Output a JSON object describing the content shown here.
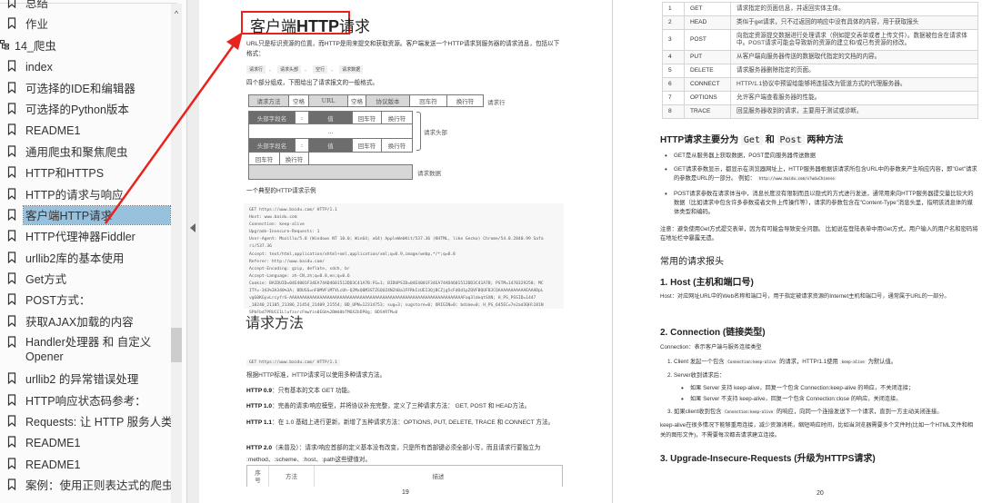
{
  "sidebar": {
    "items": [
      {
        "label": "总结",
        "type": "bookmark"
      },
      {
        "label": "作业",
        "type": "bookmark"
      },
      {
        "label": "14_爬虫",
        "type": "group"
      },
      {
        "label": "index",
        "type": "bookmark"
      },
      {
        "label": "可选择的IDE和编辑器",
        "type": "bookmark"
      },
      {
        "label": "可选择的Python版本",
        "type": "bookmark"
      },
      {
        "label": "README1",
        "type": "bookmark"
      },
      {
        "label": "通用爬虫和聚焦爬虫",
        "type": "bookmark"
      },
      {
        "label": "HTTP和HTTPS",
        "type": "bookmark"
      },
      {
        "label": "HTTP的请求与响应",
        "type": "bookmark"
      },
      {
        "label": "客户端HTTP请求",
        "type": "bookmark",
        "selected": true
      },
      {
        "label": "HTTP代理神器Fiddler",
        "type": "bookmark"
      },
      {
        "label": "urllib2库的基本使用",
        "type": "bookmark"
      },
      {
        "label": "Get方式",
        "type": "bookmark"
      },
      {
        "label": "POST方式：",
        "type": "bookmark"
      },
      {
        "label": "获取AJAX加载的内容",
        "type": "bookmark"
      },
      {
        "label": "Handler处理器 和 自定义Opener",
        "type": "bookmark",
        "tall": true
      },
      {
        "label": "urllib2 的异常错误处理",
        "type": "bookmark"
      },
      {
        "label": "HTTP响应状态码参考：",
        "type": "bookmark"
      },
      {
        "label": "Requests: 让 HTTP 服务人类",
        "type": "bookmark"
      },
      {
        "label": "README1",
        "type": "bookmark"
      },
      {
        "label": "README1",
        "type": "bookmark"
      },
      {
        "label": "案例：使用正则表达式的爬虫",
        "type": "bookmark"
      }
    ],
    "scroll_up_glyph": "^",
    "scroll_position": 0.78
  },
  "annotation": {
    "color": "#e8231e"
  },
  "page19": {
    "title_cn1": "客户端",
    "title_bold": "HTTP",
    "title_cn2": "请求",
    "intro": "URL只是标识资源的位置，而HTTP是用来提交和获取资源。客户端发送一个HTTP请求到服务器的请求消息，包括以下格式：",
    "tokens": [
      "请求行",
      "请求头部",
      "空行",
      "请求数据"
    ],
    "token_sep": "、",
    "four_parts": "四个部分组成，下图给出了请求报文的一般格式。",
    "diagram": {
      "row1": [
        "请求方法",
        "空格",
        "URL",
        "空格",
        "协议版本",
        "回车符",
        "换行符"
      ],
      "row1_label": "请求行",
      "header_name": "头部字段名",
      "colon": ":",
      "value": "值",
      "cr": "回车符",
      "lf": "换行符",
      "ellipsis": "…",
      "header_label": "请求头部",
      "data_label": "请求数据"
    },
    "example_caption": "一个典型的HTTP请求示例",
    "code_lines": [
      "GET https://www.baidu.com/ HTTP/1.1",
      "Host: www.baidu.com",
      "Connection: keep-alive",
      "Upgrade-Insecure-Requests: 1",
      "User-Agent: Mozilla/5.0 (Windows NT 10.0; Win64; x64) AppleWebKit/537.36 (KHTML, like Gecko) Chrome/54.0.2840.99 Safa",
      "ri/537.36",
      "Accept: text/html,application/xhtml+xml,application/xml;q=0.9,image/webp,*/*;q=0.8",
      "Referer: http://www.baidu.com/",
      "Accept-Encoding: gzip, deflate, sdch, br",
      "Accept-Language: zh-CN,zh;q=0.8,en;q=0.6",
      "Cookie: BAIDUID=04E4001F34EA74AD4601512DD3C41A7B:FG=1; BIDUPSID=04E4001F34EA74AD4601512DD3C41A7B; PSTM=1470329258; MC",
      "ITY=-343%3A340%3A; BDUSS=nF0MVFiMTVLcUh-Q2MxQ0M3STZGQUZ4N2hBa1FFRkIzUEI3QjBCZjg5cFdOd1pZQVFBQUFBJCQAAAAAAAAAAAEAAADpL",
      "vgG0KGyvLrcyfrG-AAAAAAAAAAAAAAAAAAAAAAAAAAAAAAAAAAAAAAAAAAAAAAAAAAAAAAAAAAAAAAAAAAAAAFaq3ldeqtSXN; H_PS_PSSID=1447",
      "_18240_21105_21386_21454_21409_21554; BD_UPN=12314753; sug=3; sugstore=0; ORIGIN=0; bdime=0; H_PS_645EC=7e2ad3QHl181N",
      "SPbFbd7PRUCE1LlufzxrcFmwYin0E6b%2BWd0bTMOXZbDP0g; BDSVRTM=0"
    ],
    "section_heading": "请求方法",
    "request_line_code": "GET https://www.baidu.com/ HTTP/1.1",
    "paragraphs": [
      {
        "bold": "",
        "text": "根据HTTP标准，HTTP请求可以使用多种请求方法。"
      },
      {
        "bold": "HTTP 0.9",
        "text": "：只有基本的文本 GET 功能。"
      },
      {
        "bold": "HTTP 1.0",
        "text": "：完善的请求/响应模型，并将协议补充完整，定义了三种请求方法： GET, POST 和 HEAD方法。"
      },
      {
        "bold": "HTTP 1.1",
        "text": "：在 1.0 基础上进行更新，新增了五种请求方法：OPTIONS, PUT, DELETE, TRACE 和 CONNECT 方法。"
      },
      {
        "bold": "HTTP 2.0",
        "text": "（未普及）：请求/响应首部的定义基本没有改变，只是所有首部键必须全部小写，而且请求行要独立为 :method、:scheme、:host、:path这些键值对。"
      }
    ],
    "table_headers": [
      "序号",
      "方法",
      "描述"
    ],
    "page_number": "19"
  },
  "page20": {
    "methods": [
      {
        "n": "1",
        "method": "GET",
        "desc": "请求指定的页面信息，并返回实体主体。"
      },
      {
        "n": "2",
        "method": "HEAD",
        "desc": "类似于get请求，只不过返回的响应中没有具体的内容，用于获取报头"
      },
      {
        "n": "3",
        "method": "POST",
        "desc": "向指定资源提交数据进行处理请求（例如提交表单或者上传文件）。数据被包含在请求体中。POST请求可能会导致新的资源的建立和/或已有资源的修改。"
      },
      {
        "n": "4",
        "method": "PUT",
        "desc": "从客户端向服务器传送的数据取代指定的文档的内容。"
      },
      {
        "n": "5",
        "method": "DELETE",
        "desc": "请求服务器删除指定的页面。"
      },
      {
        "n": "6",
        "method": "CONNECT",
        "desc": "HTTP/1.1协议中预留给能够将连接改为管道方式的代理服务器。"
      },
      {
        "n": "7",
        "method": "OPTIONS",
        "desc": "允许客户端查看服务器的性能。"
      },
      {
        "n": "8",
        "method": "TRACE",
        "desc": "回显服务器收到的请求，主要用于测试或诊断。"
      }
    ],
    "getpost_heading_pre": "HTTP请求主要分为",
    "getpost_get": "Get",
    "getpost_and": "和",
    "getpost_post": "Post",
    "getpost_heading_post": "两种方法",
    "bullets": [
      "GET是从服务器上获取数据，POST是向服务器传送数据",
      "GET请求参数显示，都显示在浏览器网址上，HTTP服务器根据该请求所包含URL中的参数来产生响应内容，即\"Get\"请求的参数是URL的一部分。 例如：",
      "POST请求参数在请求体当中，消息长度没有限制而且以隐式的方式进行发送，通常用来向HTTP服务器提交量比较大的数据（比如请求中包含许多参数或者文件上传操作等），请求的参数包含在\"Content-Type\"消息头里，指明该消息体的媒体类型和编码。"
    ],
    "bullet_example_code": "http://www.baidu.com/s?wd=Chinese",
    "note": "注意：避免使用Get方式提交表单，因为有可能会导致安全问题。 比如说在登陆表单中用Get方式，用户输入的用户名和密码将在地址栏中暴露无遗。",
    "common_headers": "常用的请求报头",
    "host_heading": "1. Host (主机和端口号)",
    "host_text": "Host：对应网址URL中的Web名称和端口号，用于指定被请求资源的Internet主机和端口号，通常属于URL的一部分。",
    "conn_heading": "2. Connection (链接类型)",
    "conn_text": "Connection：表示客户端与服务连接类型",
    "conn_items": [
      {
        "num": "1.",
        "pre": "Client 发起一个包含",
        "code": "Connection:keep-alive",
        "post": "的请求，HTTP/1.1使用",
        "code2": "keep-alive",
        "post2": "为默认值。"
      },
      {
        "num": "2.",
        "pre": "Server收到请求后："
      },
      {
        "num": "3.",
        "pre": "如果client收到包含",
        "code": "Connection:keep-alive",
        "post": "的响应，向同一个连接发送下一个请求，直到一方主动关闭连接。"
      }
    ],
    "conn_sub": [
      "如果 Server 支持 keep-alive，回复一个包含 Connection:keep-alive 的响应，不关闭连接；",
      "如果 Server 不支持 keep-alive，回复一个包含 Connection:close 的响应，关闭连接。"
    ],
    "keepalive_text": "keep-alive在很多情况下能够重用连接，减少资源消耗，缩短响应时间，比如当浏览器需要多个文件时(比如一个HTML文件和相关的图形文件)，不需要每次都去请求建立连接。",
    "upgrade_heading": "3. Upgrade-Insecure-Requests (升级为HTTPS请求)",
    "page_number": "20"
  }
}
